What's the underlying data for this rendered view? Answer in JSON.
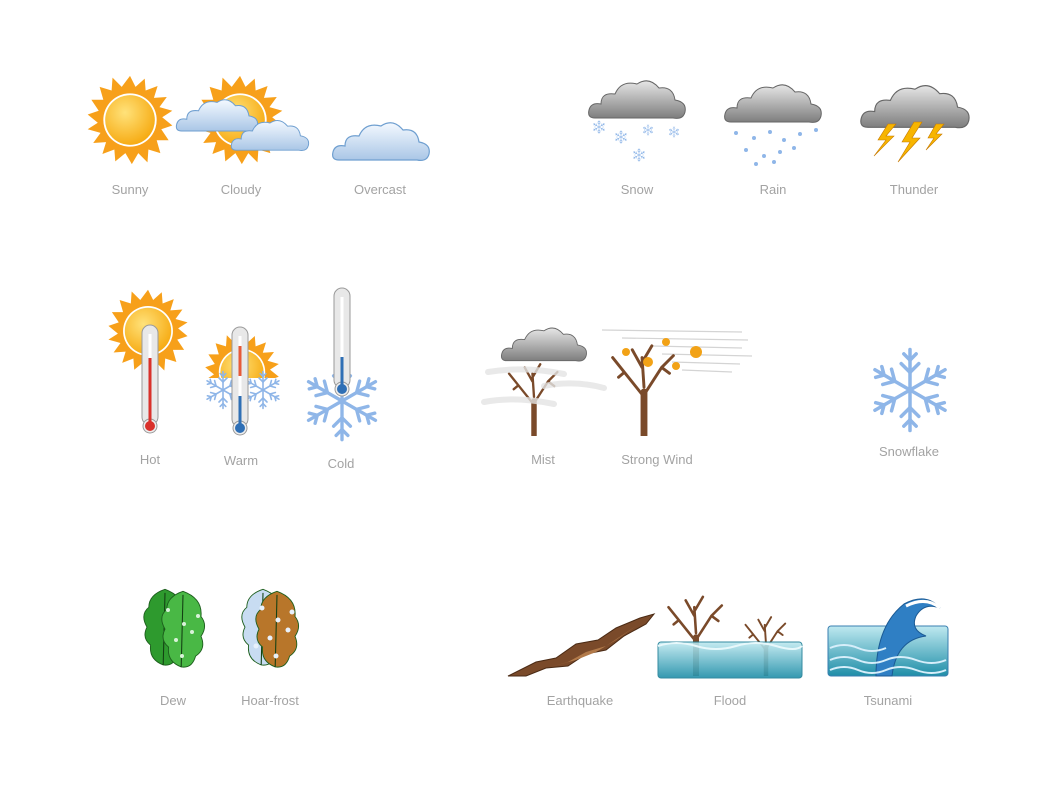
{
  "sections": {
    "sky": [
      {
        "label": "Sunny",
        "icon": "sun-icon"
      },
      {
        "label": "Cloudy",
        "icon": "sun-behind-clouds-icon"
      },
      {
        "label": "Overcast",
        "icon": "cloud-icon"
      }
    ],
    "precipitation": [
      {
        "label": "Snow",
        "icon": "snow-cloud-icon"
      },
      {
        "label": "Rain",
        "icon": "rain-cloud-icon"
      },
      {
        "label": "Thunder",
        "icon": "thunder-cloud-icon"
      }
    ],
    "temperature": [
      {
        "label": "Hot",
        "icon": "hot-thermometer-icon"
      },
      {
        "label": "Warm",
        "icon": "warm-thermometer-icon"
      },
      {
        "label": "Cold",
        "icon": "cold-thermometer-icon"
      }
    ],
    "conditions": [
      {
        "label": "Mist",
        "icon": "mist-tree-icon"
      },
      {
        "label": "Strong Wind",
        "icon": "wind-tree-icon"
      },
      {
        "label": "Snowflake",
        "icon": "snowflake-icon"
      }
    ],
    "moisture": [
      {
        "label": "Dew",
        "icon": "dew-leaf-icon"
      },
      {
        "label": "Hoar-frost",
        "icon": "frost-leaf-icon"
      }
    ],
    "disasters": [
      {
        "label": "Earthquake",
        "icon": "earthquake-icon"
      },
      {
        "label": "Flood",
        "icon": "flood-icon"
      },
      {
        "label": "Tsunami",
        "icon": "tsunami-icon"
      }
    ]
  },
  "colors": {
    "label": "#a3a3a3",
    "sun": "#fbb514",
    "sun_rays": "#f7a01a",
    "cloud": "#c9def2",
    "storm_cloud": "#8e8e8e",
    "snow": "#8fb6e8",
    "tree": "#7a4a2a",
    "water": "#3fa8bf",
    "leaf_dew": "#2e9a2e",
    "leaf_frost": "#b8762a"
  }
}
